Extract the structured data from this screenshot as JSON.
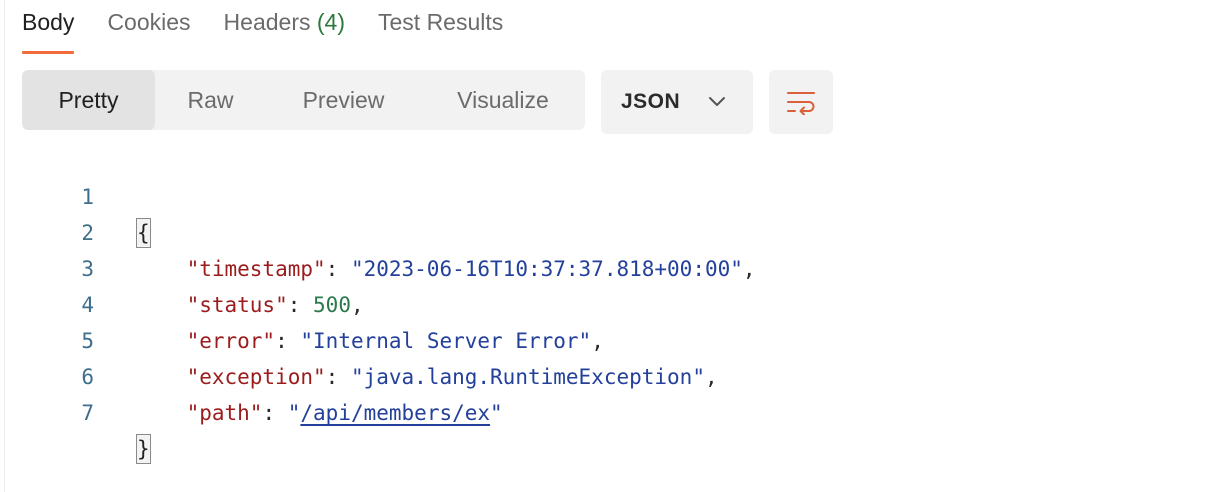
{
  "tabs": [
    {
      "label": "Body",
      "active": true
    },
    {
      "label": "Cookies"
    },
    {
      "label": "Headers ",
      "count": "(4)"
    },
    {
      "label": "Test Results"
    }
  ],
  "view_modes": [
    "Pretty",
    "Raw",
    "Preview",
    "Visualize"
  ],
  "active_view_mode": "Pretty",
  "format": {
    "selected": "JSON"
  },
  "icons": {
    "format_chevron": "chevron-down-icon",
    "wrap": "wrap-lines-icon"
  },
  "colors": {
    "accent": "#f26b3a",
    "key": "#9b1c1c",
    "string": "#23409a",
    "number": "#2c7a4b",
    "line_number": "#3f6e8c"
  },
  "response": {
    "line_numbers": [
      "1",
      "2",
      "3",
      "4",
      "5",
      "6",
      "7"
    ],
    "open_brace": "{",
    "close_brace": "}",
    "fields": [
      {
        "key": "\"timestamp\"",
        "value": "\"2023-06-16T10:37:37.818+00:00\"",
        "type": "string"
      },
      {
        "key": "\"status\"",
        "value": "500",
        "type": "number"
      },
      {
        "key": "\"error\"",
        "value": "\"Internal Server Error\"",
        "type": "string"
      },
      {
        "key": "\"exception\"",
        "value": "\"java.lang.RuntimeException\"",
        "type": "string"
      },
      {
        "key": "\"path\"",
        "value_quote": "\"",
        "value_link": "/api/members/ex",
        "type": "link"
      }
    ]
  }
}
